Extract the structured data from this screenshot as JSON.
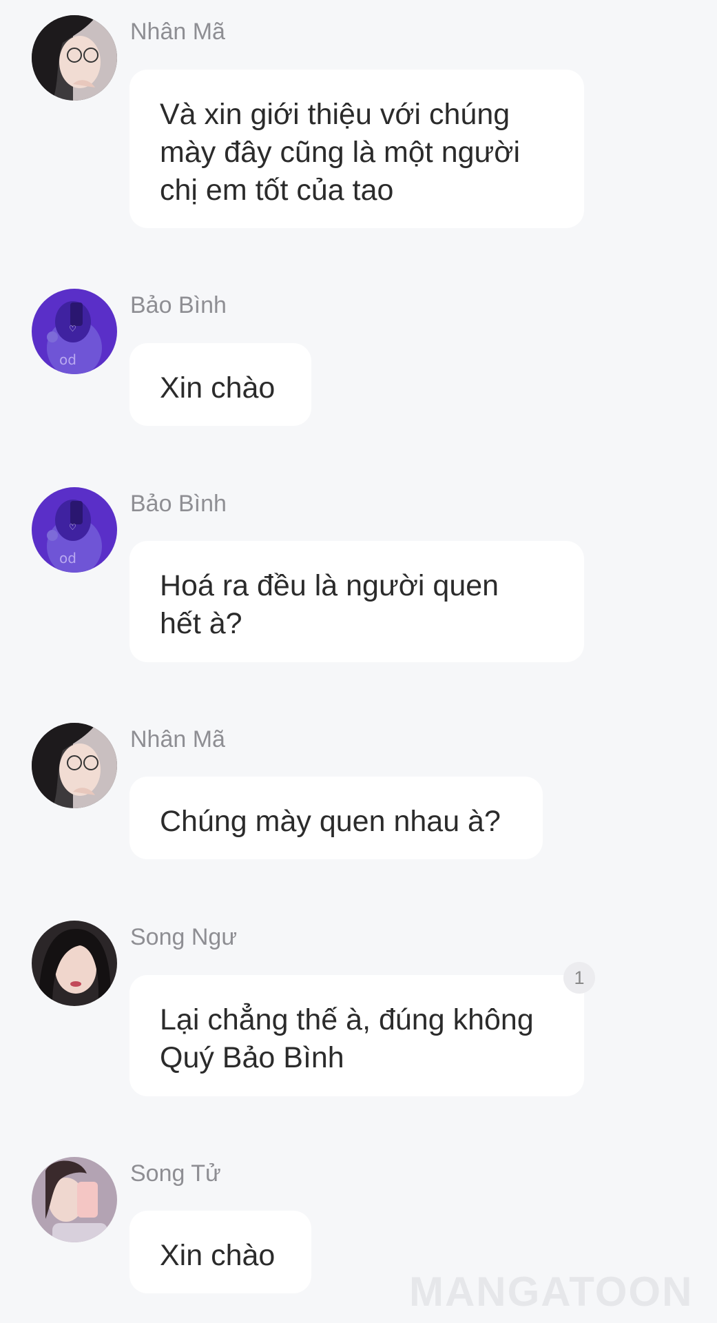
{
  "messages": [
    {
      "sender": "Nhân Mã",
      "avatar_icon": "avatar-nhan-ma",
      "lines": [
        "Và xin giới thiệu với chúng",
        "mày đây cũng là một người",
        "chị em tốt của tao"
      ]
    },
    {
      "sender": "Bảo Bình",
      "avatar_icon": "avatar-bao-binh",
      "lines": [
        "Xin chào"
      ]
    },
    {
      "sender": "Bảo Bình",
      "avatar_icon": "avatar-bao-binh",
      "lines": [
        "Hoá ra đều là người quen",
        "hết à?"
      ]
    },
    {
      "sender": "Nhân Mã",
      "avatar_icon": "avatar-nhan-ma",
      "lines": [
        "Chúng mày quen nhau à?"
      ]
    },
    {
      "sender": "Song Ngư",
      "avatar_icon": "avatar-song-ngu",
      "lines": [
        "Lại chẳng thế à, đúng không",
        "Quý Bảo Bình"
      ],
      "badge": "1"
    },
    {
      "sender": "Song Tử",
      "avatar_icon": "avatar-song-tu",
      "lines": [
        "Xin chào"
      ]
    }
  ],
  "watermark": "MANGATOON",
  "colors": {
    "background": "#f6f7f9",
    "bubble": "#ffffff",
    "sender_text": "#8e8e93",
    "message_text": "#2b2b2b"
  }
}
